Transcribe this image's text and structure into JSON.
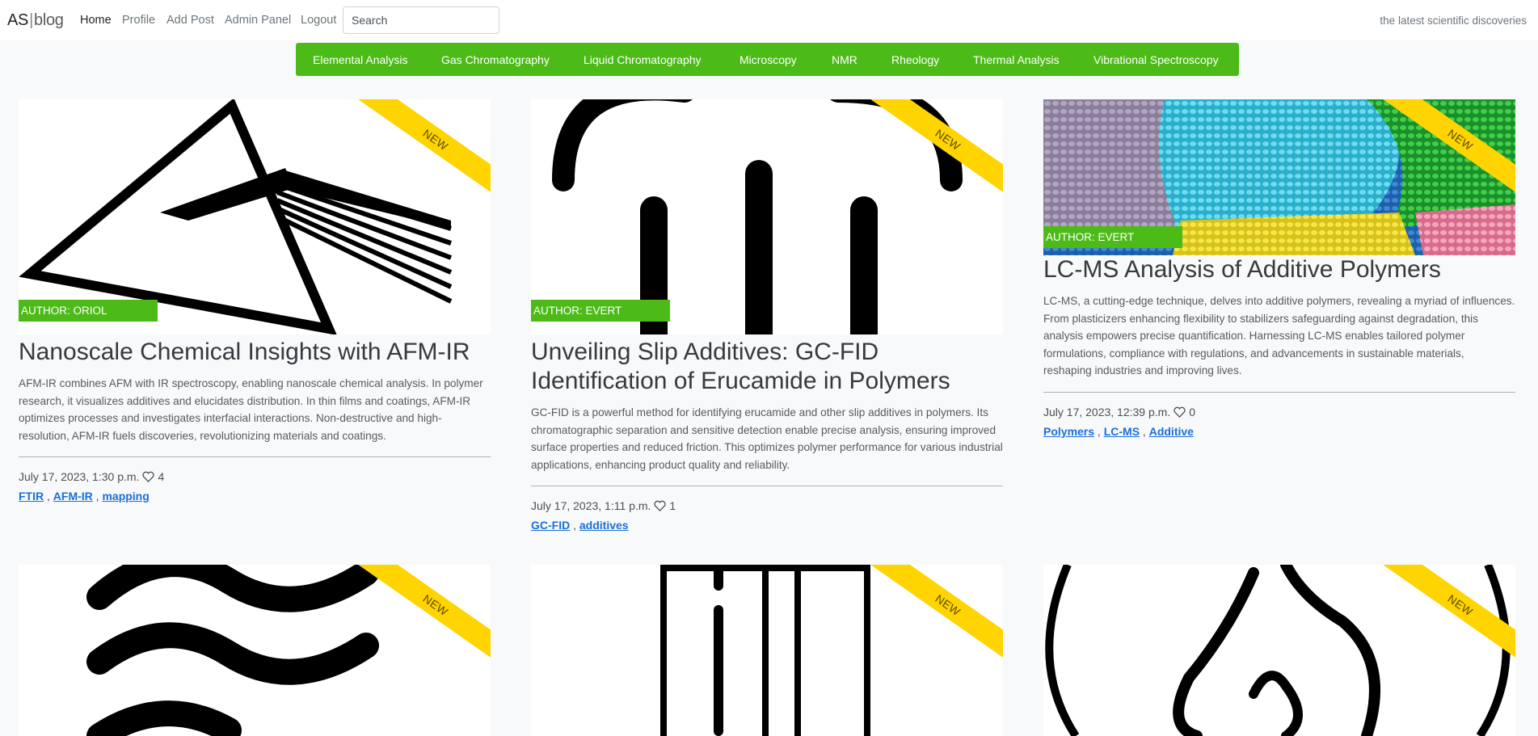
{
  "brand": {
    "part1": "AS",
    "part2": "blog"
  },
  "nav": [
    "Home",
    "Profile",
    "Add Post",
    "Admin Panel",
    "Logout"
  ],
  "search": {
    "placeholder": "Search"
  },
  "tagline": "the latest scientific discoveries",
  "categories": [
    "Elemental Analysis",
    "Gas Chromatography",
    "Liquid Chromatography",
    "Microscopy",
    "NMR",
    "Rheology",
    "Thermal Analysis",
    "Vibrational Spectroscopy"
  ],
  "ribbon_label": "NEW",
  "posts": [
    {
      "author": "AUTHOR: ORIOL",
      "title": "Nanoscale Chemical Insights with AFM-IR",
      "excerpt": "AFM-IR combines AFM with IR spectroscopy, enabling nanoscale chemical analysis. In polymer research, it visualizes additives and elucidates distribution. In thin films and coatings, AFM-IR optimizes processes and investigates interfacial interactions. Non-destructive and high-resolution, AFM-IR fuels discoveries, revolutionizing materials and coatings.",
      "date": "July 17, 2023, 1:30 p.m.",
      "likes": "4",
      "tags": [
        "FTIR",
        "AFM-IR",
        "mapping"
      ],
      "image_icon": "prism-icon"
    },
    {
      "author": "AUTHOR: EVERT",
      "title": "Unveiling Slip Additives: GC-FID Identification of Erucamide in Polymers",
      "excerpt": "GC-FID is a powerful method for identifying erucamide and other slip additives in polymers. Its chromatographic separation and sensitive detection enable precise analysis, ensuring improved surface properties and reduced friction. This optimizes polymer performance for various industrial applications, enhancing product quality and reliability.",
      "date": "July 17, 2023, 1:11 p.m.",
      "likes": "1",
      "tags": [
        "GC-FID",
        "additives"
      ],
      "image_icon": "gc-column-icon"
    },
    {
      "author": "AUTHOR: EVERT",
      "title": "LC-MS Analysis of Additive Polymers",
      "excerpt": "LC-MS, a cutting-edge technique, delves into additive polymers, revealing a myriad of influences. From plasticizers enhancing flexibility to stabilizers safeguarding against degradation, this analysis empowers precise quantification. Harnessing LC-MS enables tailored polymer formulations, compliance with regulations, and advancements in sustainable materials, reshaping industries and improving lives.",
      "date": "July 17, 2023, 12:39 p.m.",
      "likes": "0",
      "tags": [
        "Polymers",
        "LC-MS",
        "Additive"
      ],
      "image_icon": "polymer-pellets-photo"
    }
  ],
  "lower_cards": [
    {
      "image_icon": "waves-icon"
    },
    {
      "image_icon": "test-tube-icon"
    },
    {
      "image_icon": "flame-icon"
    }
  ],
  "colors": {
    "accent": "#4cbb17",
    "ribbon": "#ffd400",
    "link": "#1a6fd9"
  }
}
